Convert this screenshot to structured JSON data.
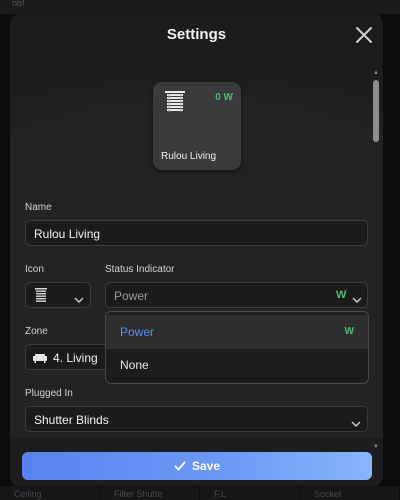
{
  "background": {
    "top_text": "no!",
    "bottom_tabs": [
      "Ceiling",
      "Filter Shutte",
      "F.L",
      "Socket"
    ]
  },
  "modal": {
    "title": "Settings",
    "close_icon": "close-icon"
  },
  "device": {
    "icon": "window-blind-icon",
    "power": "0 W",
    "name": "Rulou Living"
  },
  "form": {
    "name_label": "Name",
    "name_value": "Rulou Living",
    "icon_label": "Icon",
    "icon_value": "window-blind-icon",
    "status_label": "Status Indicator",
    "status_value": "Power",
    "status_badge": "W",
    "zone_label": "Zone",
    "zone_value": "4. Living",
    "plugged_label": "Plugged In",
    "plugged_value": "Shutter Blinds"
  },
  "status_dropdown": {
    "options": [
      {
        "label": "Power",
        "badge": "W",
        "selected": true
      },
      {
        "label": "None",
        "badge": "",
        "selected": false
      }
    ]
  },
  "footer": {
    "save_label": "Save",
    "save_icon": "check-icon"
  },
  "colors": {
    "accent_blue": "#5b8cf7",
    "power_green": "#4bbf73",
    "panel_bg": "#232325",
    "field_bg": "#1b1b1d"
  }
}
